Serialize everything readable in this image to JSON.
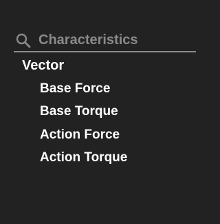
{
  "search": {
    "placeholder": "Characteristics",
    "value": "",
    "icon": "search-icon"
  },
  "tree": {
    "group_label": "Vector",
    "items": [
      {
        "label": "Base Force"
      },
      {
        "label": "Base Torque"
      },
      {
        "label": "Action Force"
      },
      {
        "label": "Action Torque"
      }
    ]
  },
  "colors": {
    "background": "#222222",
    "text": "#ffffff",
    "placeholder": "#8a8a8a",
    "underline": "#8c8c8c"
  }
}
